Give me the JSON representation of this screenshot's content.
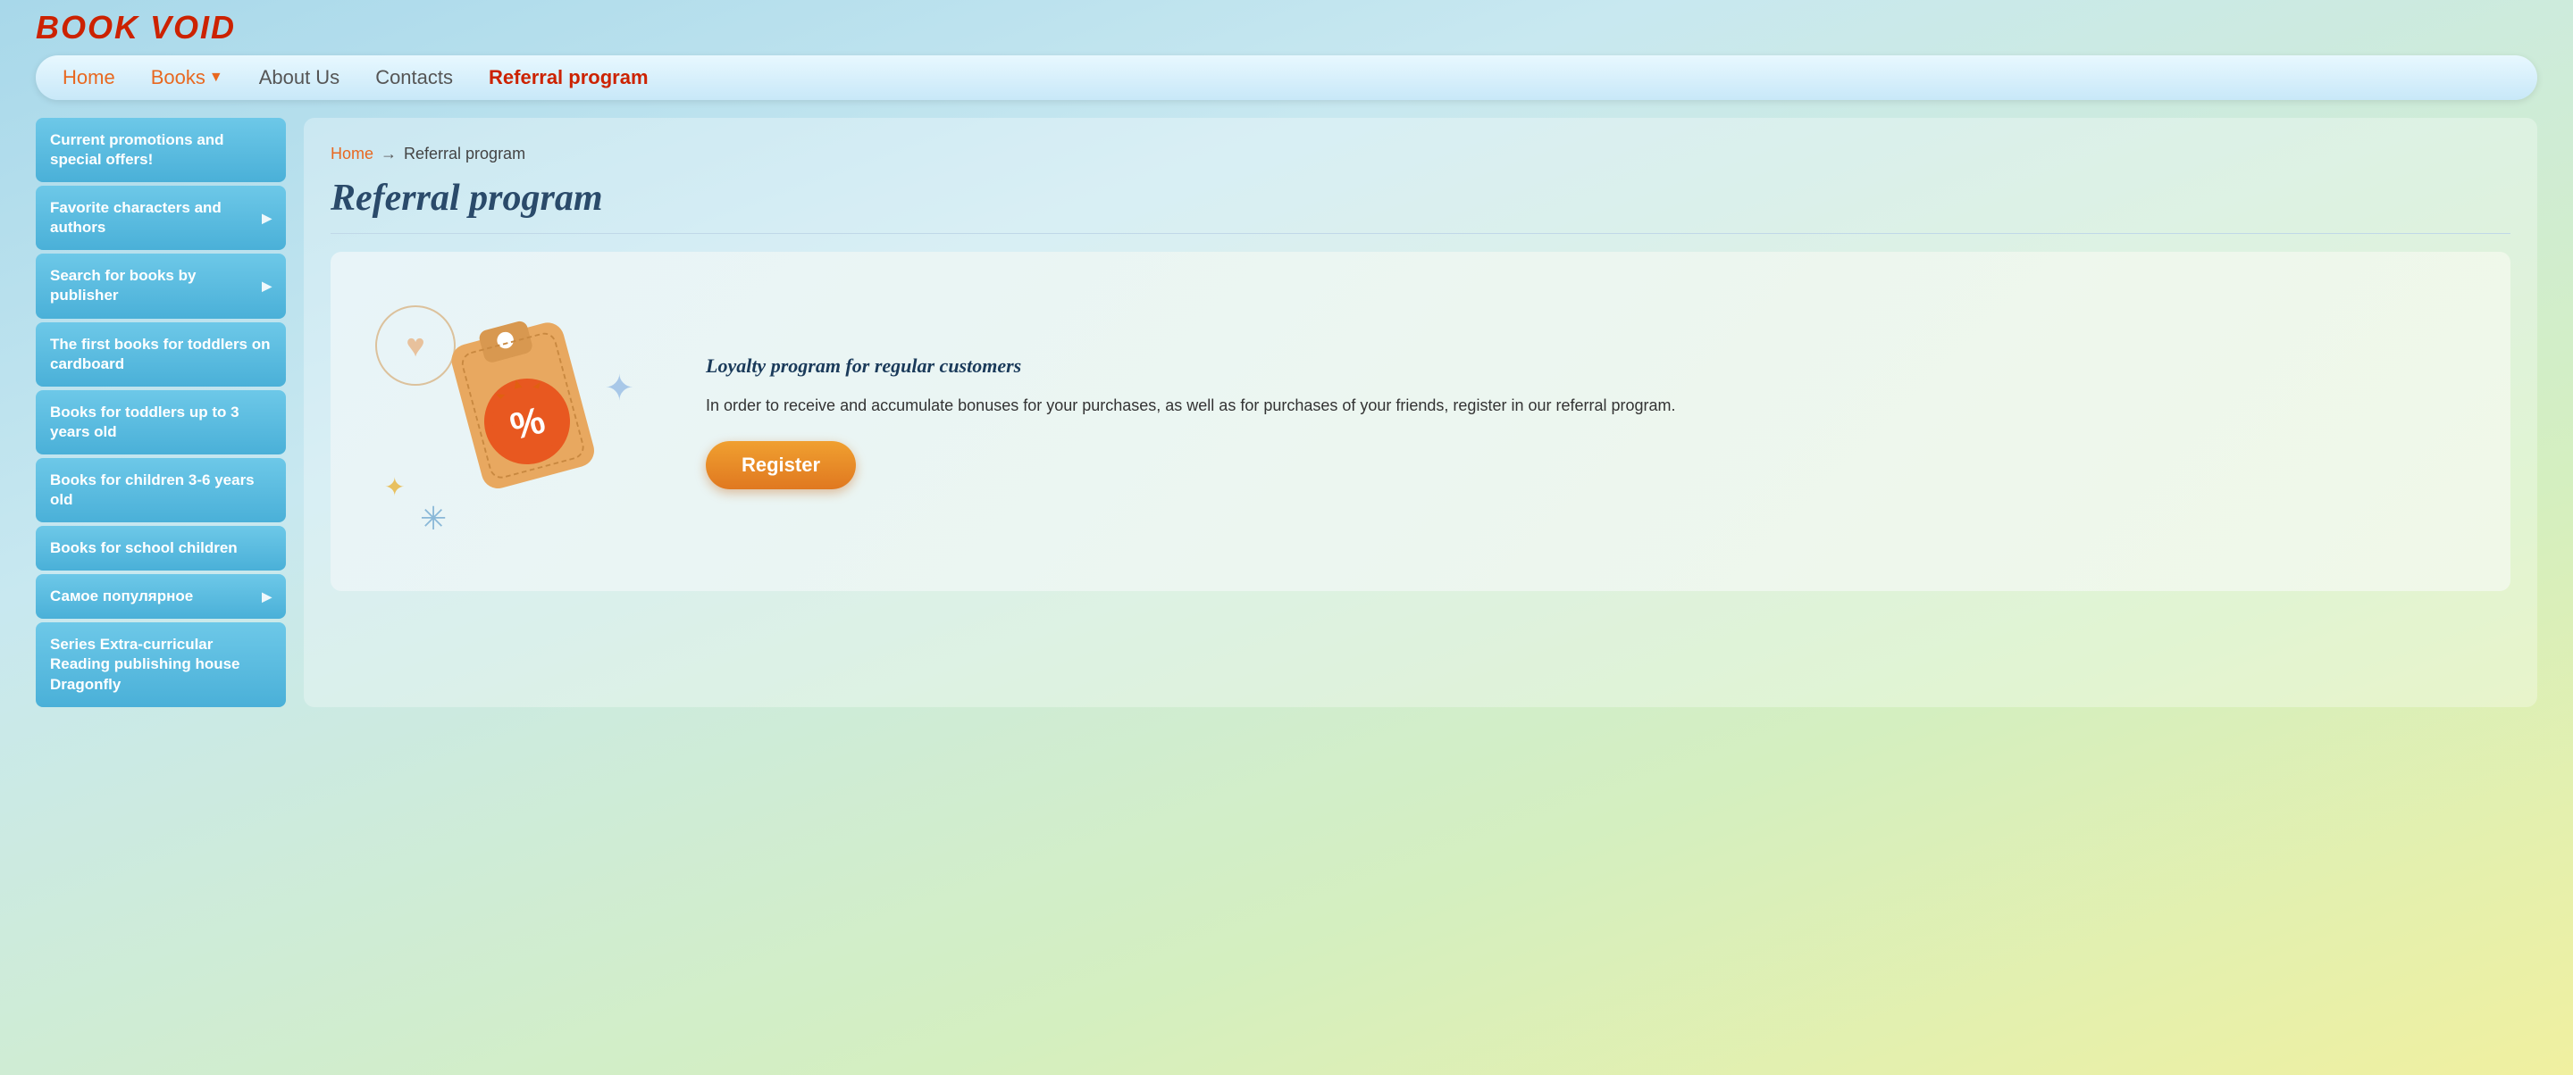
{
  "header": {
    "logo": "BOOK VOID"
  },
  "nav": {
    "items": [
      {
        "label": "Home",
        "key": "home",
        "active": false
      },
      {
        "label": "Books",
        "key": "books",
        "has_dropdown": true,
        "active": false
      },
      {
        "label": "About Us",
        "key": "about",
        "active": false
      },
      {
        "label": "Contacts",
        "key": "contacts",
        "active": false
      },
      {
        "label": "Referral program",
        "key": "referral",
        "active": true
      }
    ]
  },
  "sidebar": {
    "items": [
      {
        "label": "Current promotions and special offers!",
        "has_expand": false
      },
      {
        "label": "Favorite characters and authors",
        "has_expand": true
      },
      {
        "label": "Search for books by publisher",
        "has_expand": true
      },
      {
        "label": "The first books for toddlers on cardboard",
        "has_expand": false
      },
      {
        "label": "Books for toddlers up to 3 years old",
        "has_expand": false
      },
      {
        "label": "Books for children 3-6 years old",
        "has_expand": false
      },
      {
        "label": "Books for school children",
        "has_expand": false
      },
      {
        "label": "Самое популярное",
        "has_expand": true
      },
      {
        "label": "Series Extra-curricular Reading publishing house Dragonfly",
        "has_expand": false
      }
    ]
  },
  "content": {
    "breadcrumb_home": "Home",
    "breadcrumb_arrow": "→",
    "breadcrumb_current": "Referral program",
    "page_title": "Referral program",
    "card": {
      "loyalty_title": "Loyalty program for regular customers",
      "loyalty_desc": "In order to receive and accumulate bonuses for your purchases, as well as for purchases of your friends, register in our referral program.",
      "register_btn": "Register"
    }
  },
  "colors": {
    "orange_nav": "#e86820",
    "active_nav": "#cc2200",
    "sidebar_bg": "#4ab0d8",
    "tag_body": "#e8a860",
    "tag_badge": "#e85820",
    "register_btn": "#e07820"
  }
}
